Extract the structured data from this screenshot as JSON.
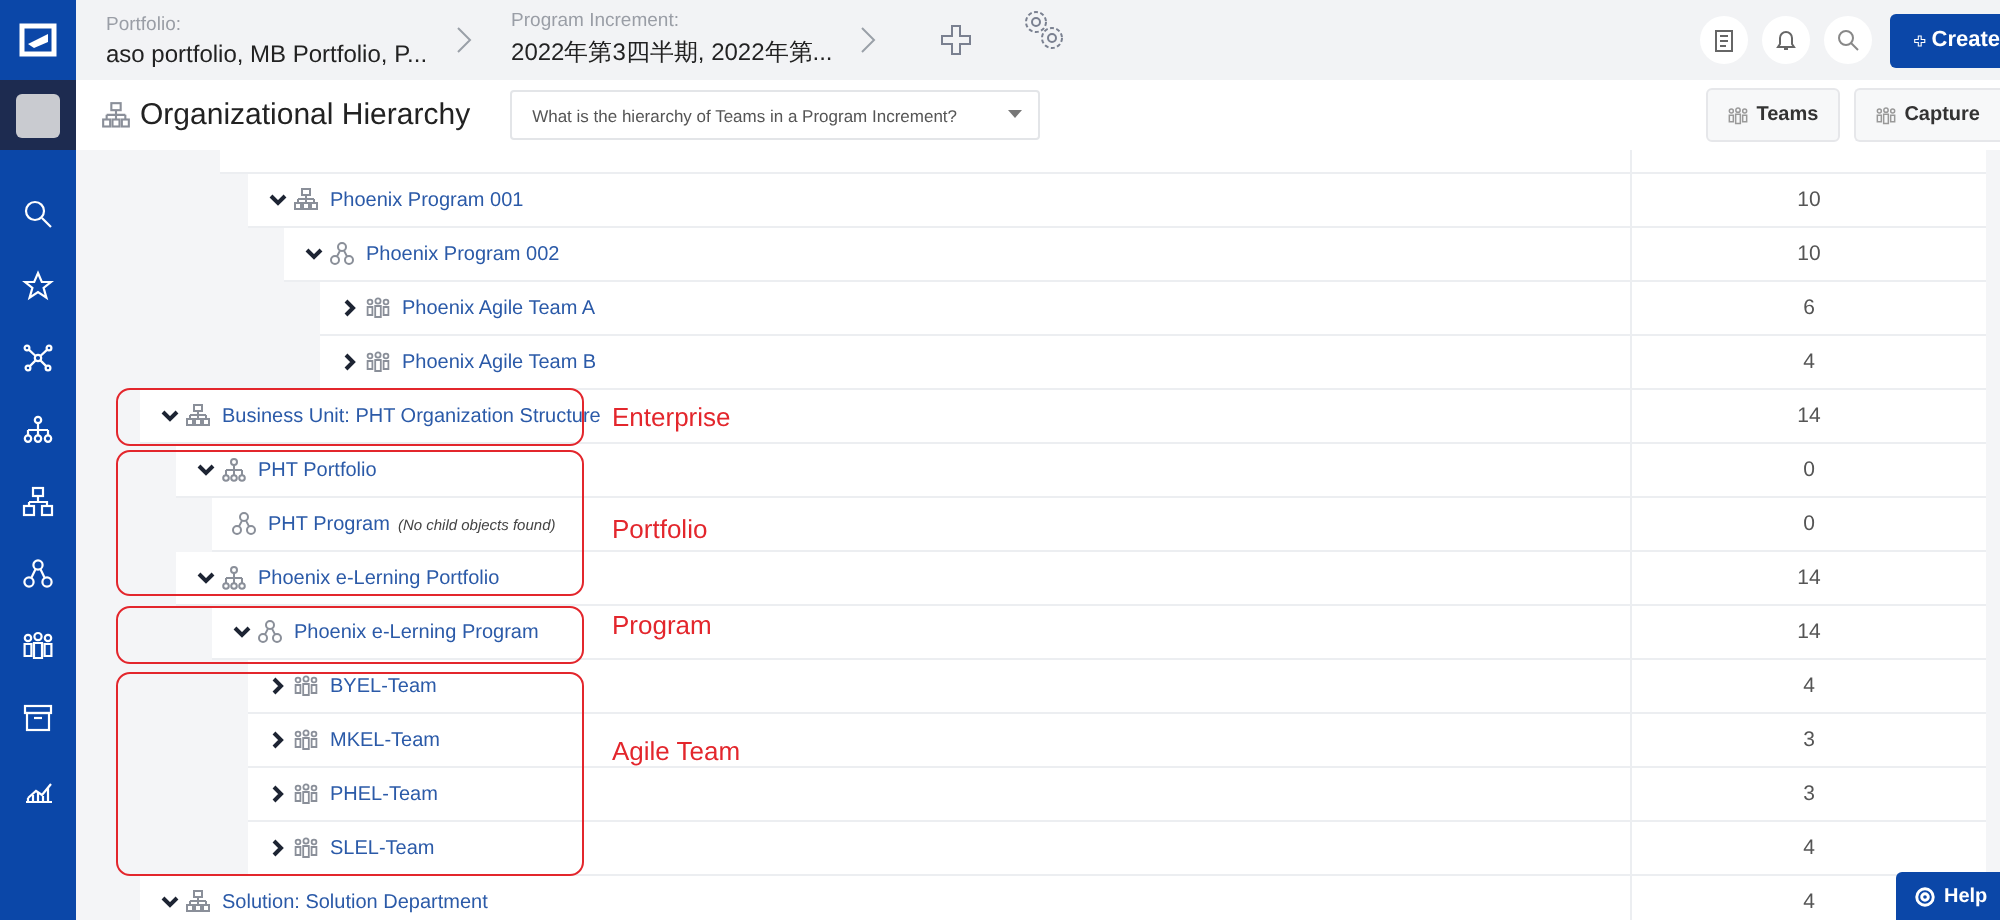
{
  "top_bar": {
    "breadcrumbs": [
      {
        "label": "Portfolio:",
        "value": "aso portfolio, MB Portfolio, P..."
      },
      {
        "label": "Program Increment:",
        "value": "2022年第3四半期, 2022年第..."
      }
    ],
    "create_button": "Create"
  },
  "page_title": "Organizational Hierarchy",
  "question_select": {
    "placeholder": "What is the hierarchy of Teams in a Program Increment?"
  },
  "toolbar_buttons": [
    "Teams",
    "Capture"
  ],
  "tree": {
    "partial_branch": [
      {
        "name": "Phoenix Program 001",
        "kind": "structure",
        "has_children": true,
        "expanded": true,
        "count": "10",
        "children": [
          {
            "name": "Phoenix Program 002",
            "kind": "program",
            "has_children": true,
            "expanded": true,
            "count": "10",
            "children": [
              {
                "name": "Phoenix Agile Team A",
                "kind": "team",
                "has_children": true,
                "expanded": false,
                "count": "6"
              },
              {
                "name": "Phoenix Agile Team B",
                "kind": "team",
                "has_children": true,
                "expanded": false,
                "count": "4"
              }
            ]
          }
        ]
      }
    ],
    "roots": [
      {
        "name": "Business Unit: PHT Organization Structure",
        "kind": "structure",
        "has_children": true,
        "expanded": true,
        "count": "14",
        "children": [
          {
            "name": "PHT Portfolio",
            "kind": "portfolio",
            "has_children": true,
            "expanded": true,
            "count": "0",
            "children": [
              {
                "name": "PHT Program",
                "note": "(No child objects found)",
                "kind": "program",
                "has_children": false,
                "expanded": false,
                "count": "0"
              }
            ]
          },
          {
            "name": "Phoenix e-Lerning Portfolio",
            "kind": "portfolio",
            "has_children": true,
            "expanded": true,
            "count": "14",
            "children": [
              {
                "name": "Phoenix e-Lerning Program",
                "kind": "program",
                "has_children": true,
                "expanded": true,
                "count": "14",
                "children": [
                  {
                    "name": "BYEL-Team",
                    "kind": "team",
                    "has_children": true,
                    "expanded": false,
                    "count": "4"
                  },
                  {
                    "name": "MKEL-Team",
                    "kind": "team",
                    "has_children": true,
                    "expanded": false,
                    "count": "3"
                  },
                  {
                    "name": "PHEL-Team",
                    "kind": "team",
                    "has_children": true,
                    "expanded": false,
                    "count": "3"
                  },
                  {
                    "name": "SLEL-Team",
                    "kind": "team",
                    "has_children": true,
                    "expanded": false,
                    "count": "4"
                  }
                ]
              }
            ]
          }
        ]
      },
      {
        "name": "Solution: Solution Department",
        "kind": "structure",
        "has_children": true,
        "expanded": true,
        "count": "4"
      }
    ]
  },
  "annotations": [
    {
      "label": "Enterprise"
    },
    {
      "label": "Portfolio"
    },
    {
      "label": "Program"
    },
    {
      "label": "Agile Team"
    }
  ],
  "help_button": "Help"
}
